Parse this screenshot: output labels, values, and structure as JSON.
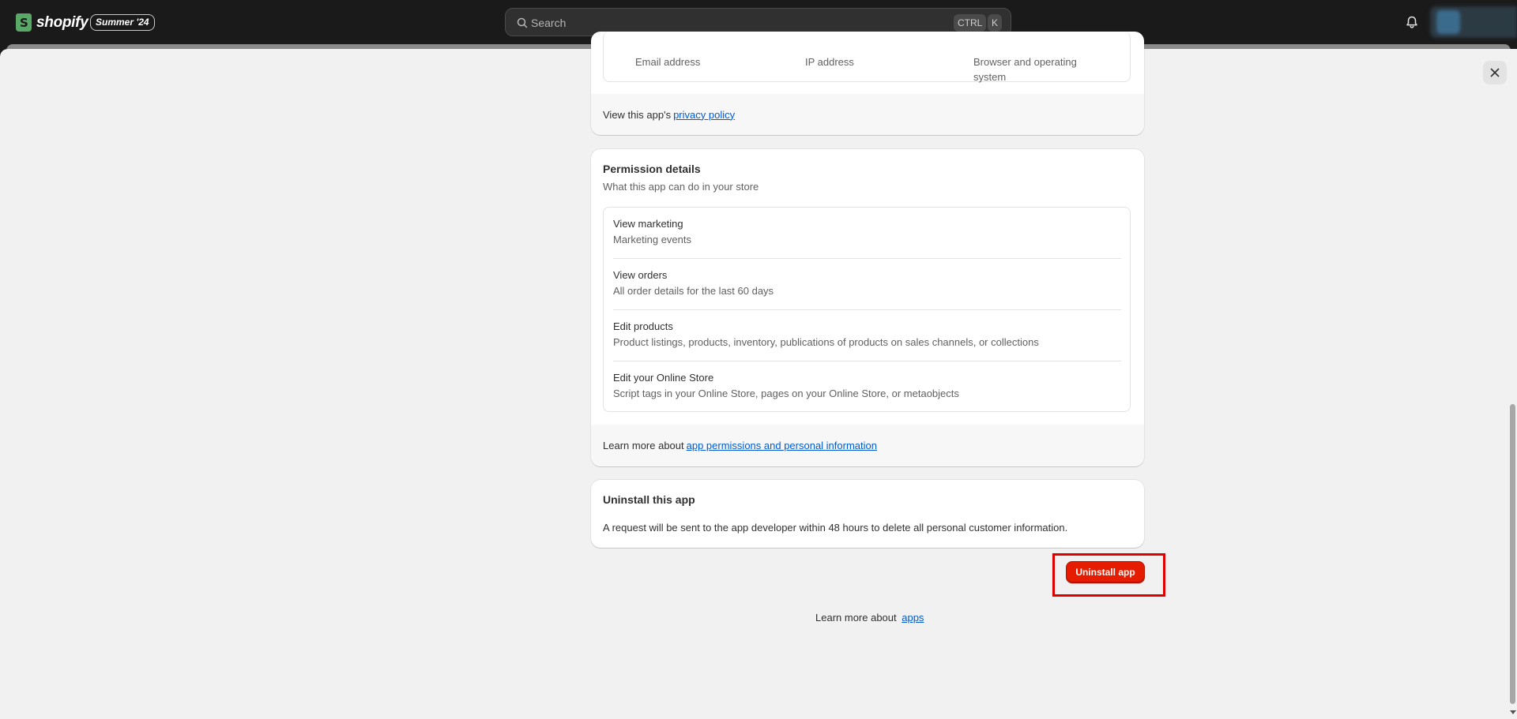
{
  "topbar": {
    "logo_text": "shopify",
    "edition_badge": "Summer '24",
    "search_placeholder": "Search",
    "shortcut_ctrl": "CTRL",
    "shortcut_k": "K"
  },
  "data_card": {
    "cut_labels": [
      "Email address",
      "IP address",
      "Browser and operating",
      "system"
    ],
    "footer_prefix": "View this app's ",
    "footer_link": "privacy policy"
  },
  "permissions": {
    "title": "Permission details",
    "subtitle": "What this app can do in your store",
    "items": [
      {
        "title": "View marketing",
        "desc": "Marketing events"
      },
      {
        "title": "View orders",
        "desc": "All order details for the last 60 days"
      },
      {
        "title": "Edit products",
        "desc": "Product listings, products, inventory, publications of products on sales channels, or collections"
      },
      {
        "title": "Edit your Online Store",
        "desc": "Script tags in your Online Store, pages on your Online Store, or metaobjects"
      }
    ],
    "footer_prefix": "Learn more about ",
    "footer_link": "app permissions and personal information"
  },
  "uninstall": {
    "title": "Uninstall this app",
    "body": "A request will be sent to the app developer within 48 hours to delete all personal customer information.",
    "button_label": "Uninstall app"
  },
  "bottom": {
    "prefix": "Learn more about ",
    "link": "apps"
  },
  "colors": {
    "accent_link": "#005bd3",
    "danger": "#e51c00",
    "highlight": "#e00000"
  }
}
